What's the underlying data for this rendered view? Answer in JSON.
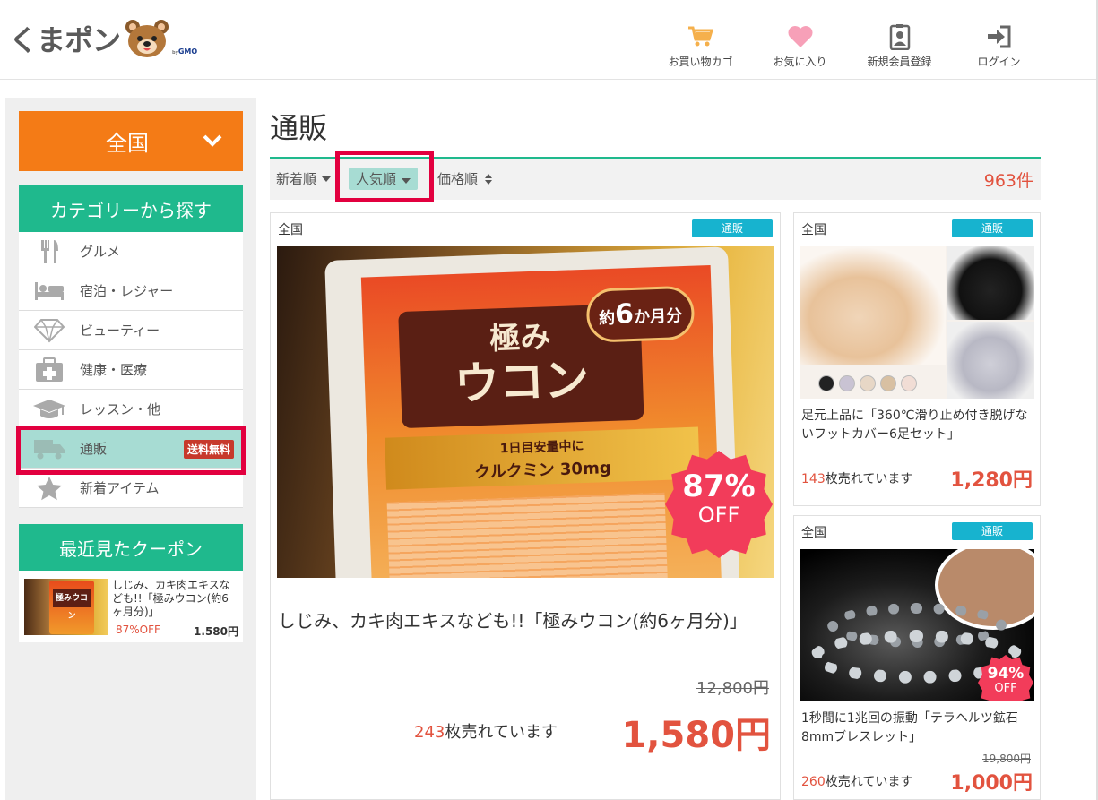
{
  "header": {
    "logo": {
      "name": "くまポン",
      "by": "by",
      "brand": "GMO"
    },
    "nav": [
      {
        "label": "お買い物カゴ",
        "icon": "cart-icon",
        "color": "#f5b04c"
      },
      {
        "label": "お気に入り",
        "icon": "heart-icon",
        "color": "#f7a0b8"
      },
      {
        "label": "新規会員登録",
        "icon": "member-card-icon",
        "color": "#666666"
      },
      {
        "label": "ログイン",
        "icon": "login-icon",
        "color": "#666666"
      }
    ]
  },
  "sidebar": {
    "area": "全国",
    "category_heading": "カテゴリーから探す",
    "categories": [
      {
        "label": "グルメ",
        "icon": "fork-knife-icon"
      },
      {
        "label": "宿泊・レジャー",
        "icon": "bed-icon"
      },
      {
        "label": "ビューティー",
        "icon": "diamond-icon"
      },
      {
        "label": "健康・医療",
        "icon": "first-aid-icon"
      },
      {
        "label": "レッスン・他",
        "icon": "graduation-cap-icon"
      },
      {
        "label": "通販",
        "icon": "truck-icon",
        "badge": "送料無料",
        "active": true
      },
      {
        "label": "新着アイテム",
        "icon": "star-icon"
      }
    ],
    "recent_heading": "最近見たクーポン",
    "recent": {
      "title": "しじみ、カキ肉エキスなども!!「極みウコン(約6ヶ月分)」",
      "off": "87%OFF",
      "price": "1.580円",
      "pack_text": "極みウコン"
    }
  },
  "main": {
    "title": "通販",
    "sort": {
      "newest": "新着順",
      "popular": "人気順",
      "price": "価格順",
      "count": "963件"
    },
    "featured": {
      "region": "全国",
      "tag": "通販",
      "title": "しじみ、カキ肉エキスなども!!「極みウコン(約6ヶ月分)」",
      "original_price": "12,800円",
      "sold_count": "243",
      "sold_suffix": "枚売れています",
      "price": "1,580円",
      "discount": "87%",
      "off": "OFF",
      "pack": {
        "line1": "極み",
        "line2": "ウコン",
        "months_prefix": "約",
        "months_num": "6",
        "months_suffix": "か月分",
        "band1": "1日目安量中に",
        "band2": "クルクミン 30mg"
      }
    },
    "items": [
      {
        "region": "全国",
        "tag": "通販",
        "title": "足元上品に「360℃滑り止め付き脱げないフットカバー6足セット」",
        "sold_count": "143",
        "sold_suffix": "枚売れています",
        "price": "1,280円"
      },
      {
        "region": "全国",
        "tag": "通販",
        "title": "1秒間に1兆回の振動「テラヘルツ鉱石8mmブレスレット」",
        "original_price": "19,800円",
        "sold_count": "260",
        "sold_suffix": "枚売れています",
        "price": "1,000円",
        "discount": "94%",
        "off": "OFF"
      }
    ]
  },
  "colors": {
    "accent": "#1fb98d",
    "area": "#f47b16",
    "price": "#e2533f",
    "tag": "#17b3cf",
    "highlight": "#e2003f"
  }
}
